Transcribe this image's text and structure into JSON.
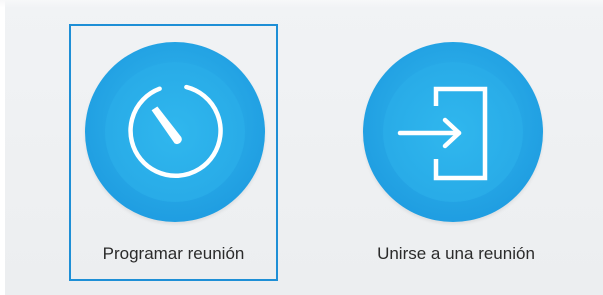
{
  "window": {
    "background": "#eceef0",
    "accent": "#1e8fd6",
    "icon_color": "#26a6e5"
  },
  "actions": [
    {
      "label": "Programar reunión",
      "icon": "timer-icon",
      "selected": true
    },
    {
      "label": "Unirse a una reunión",
      "icon": "enter-icon",
      "selected": false
    }
  ]
}
